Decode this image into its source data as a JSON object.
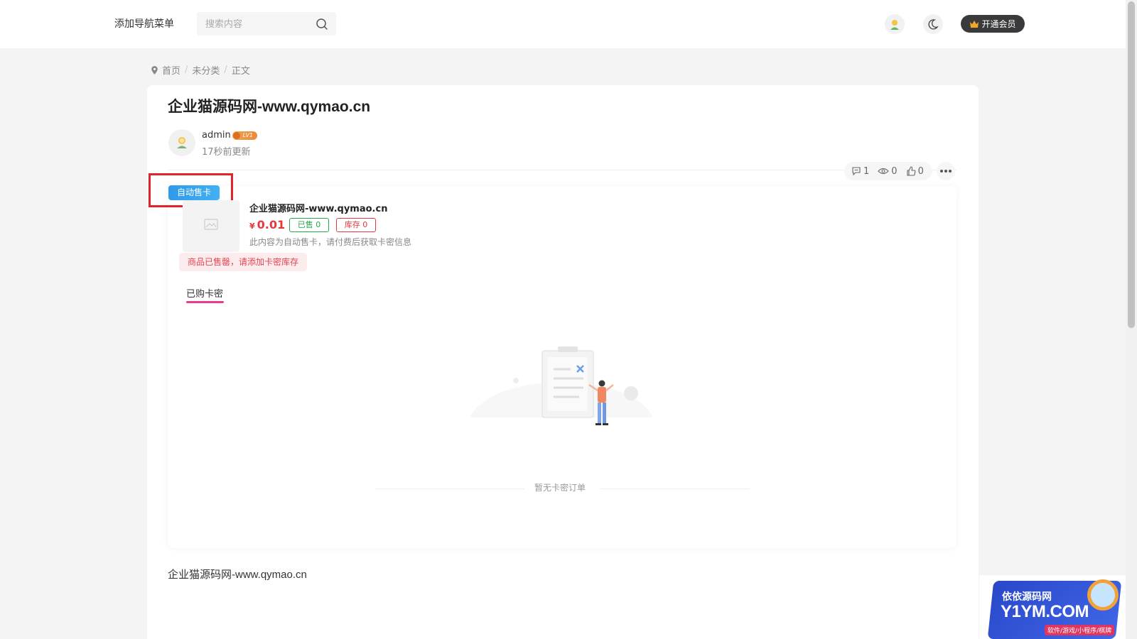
{
  "header": {
    "nav_label": "添加导航菜单",
    "search": {
      "placeholder": "搜索内容",
      "value": ""
    },
    "icons": [
      "search-icon",
      "user-avatar",
      "moon-icon",
      "crown-icon"
    ],
    "vip_label": "开通会员"
  },
  "breadcrumb": {
    "items": [
      "首页",
      "未分类",
      "正文"
    ],
    "separator": "/"
  },
  "post": {
    "title": "企业猫源码网-www.qymao.cn",
    "author": "admin",
    "level_badge": "LV1",
    "updated": "17秒前更新",
    "stats": {
      "comments": "1",
      "views": "0",
      "likes": "0"
    },
    "body_text": "企业猫源码网-www.qymao.cn"
  },
  "shop": {
    "tag": "自动售卡",
    "product_name": "企业猫源码网-www.qymao.cn",
    "price_symbol": "¥",
    "price": "0.01",
    "sold_label": "已售 0",
    "stock_label": "库存 0",
    "description": "此内容为自动售卡，请付费后获取卡密信息",
    "soldout_notice": "商品已售罄，请添加卡密库存",
    "tab_label": "已购卡密",
    "empty_text": "暂无卡密订单"
  },
  "ad": {
    "line1": "依依源码网",
    "line2": "Y1YM.COM",
    "line3": "软件/游戏/小程序/棋牌"
  },
  "colors": {
    "accent_pink": "#e83d8e",
    "price_red": "#e6393e",
    "sold_green": "#27a745",
    "tag_blue": "#2f9ae8",
    "highlight_red": "#e0242a"
  }
}
